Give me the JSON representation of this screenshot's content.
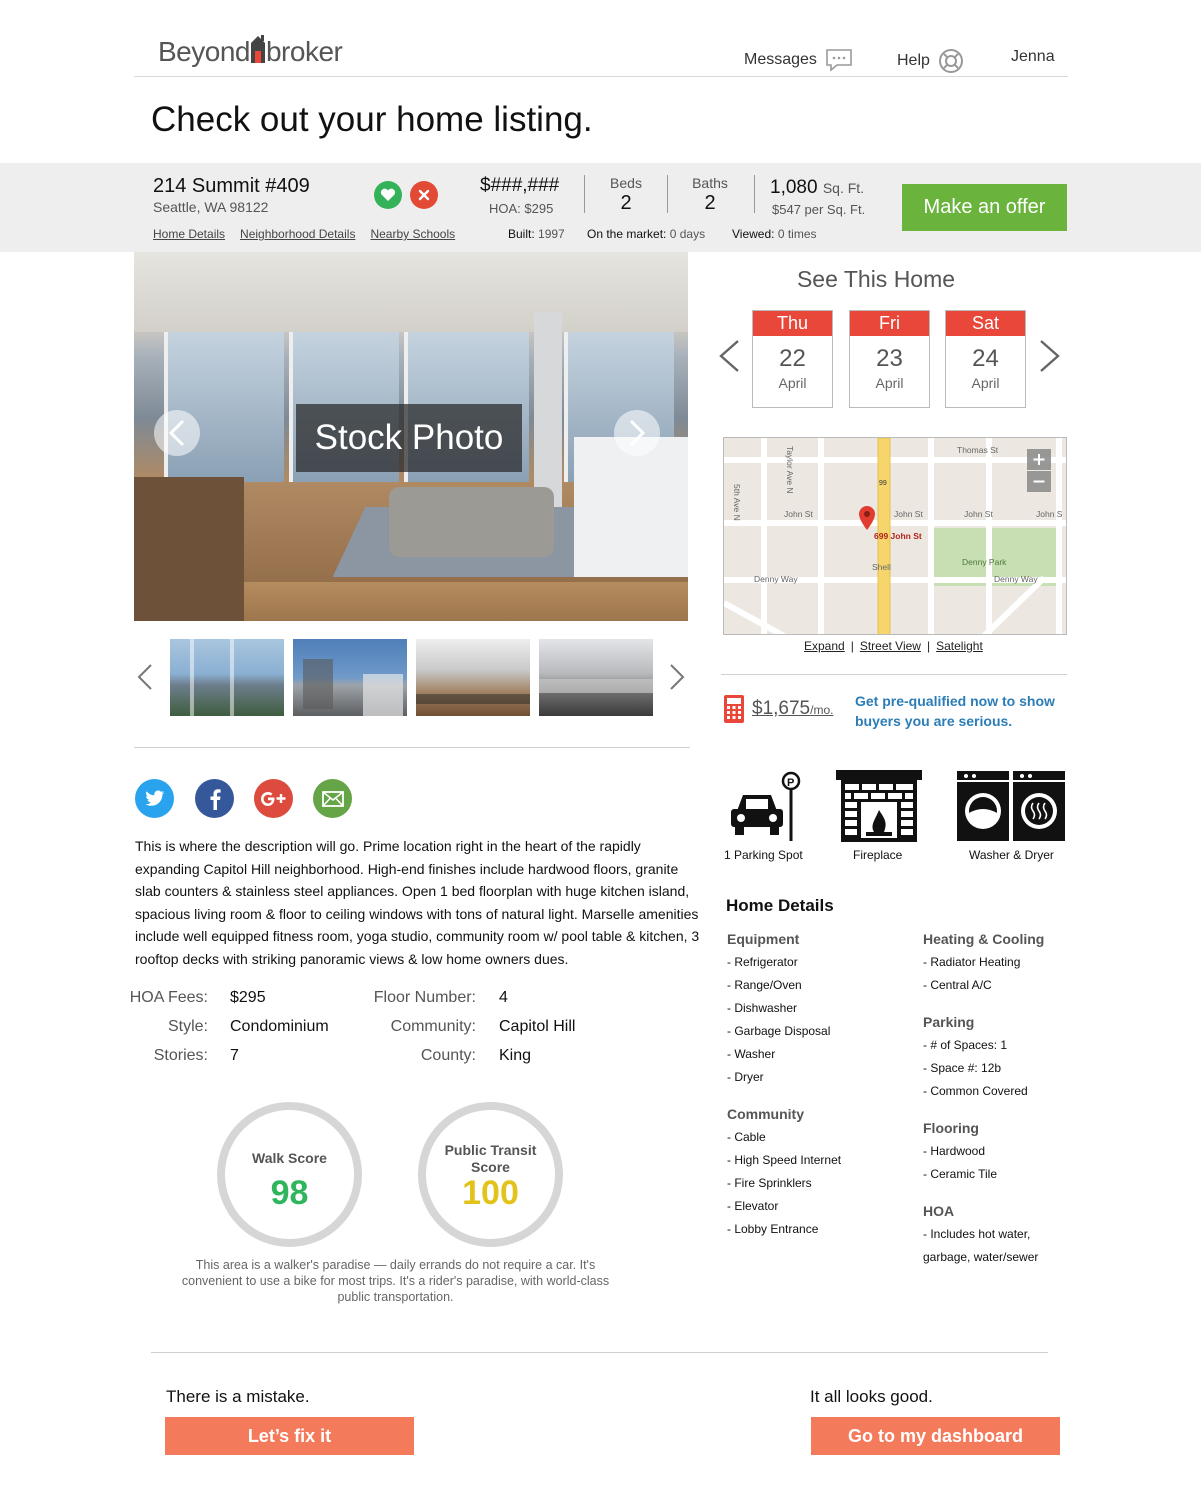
{
  "brand": {
    "name_left": "Beyond",
    "name_right": "broker"
  },
  "nav": {
    "messages": "Messages",
    "help": "Help",
    "user": "Jenna"
  },
  "page_title": "Check out your home listing.",
  "listing": {
    "address_line1": "214 Summit #409",
    "address_line2": "Seattle, WA 98122",
    "price": "$###,###",
    "hoa": "HOA: $295",
    "beds_label": "Beds",
    "beds": "2",
    "baths_label": "Baths",
    "baths": "2",
    "sqft": "1,080",
    "sqft_unit": "Sq. Ft.",
    "price_per_sqft": "$547 per Sq. Ft.",
    "offer_button": "Make an offer",
    "links": [
      "Home Details",
      "Neighborhood Details",
      "Nearby Schools"
    ],
    "built_label": "Built:",
    "built": "1997",
    "market_label": "On the market:",
    "market": "0 days",
    "viewed_label": "Viewed:",
    "viewed": "0 times"
  },
  "gallery": {
    "stock_label": "Stock Photo",
    "thumbnails": 4
  },
  "schedule": {
    "title": "See This Home",
    "days": [
      {
        "dow": "Thu",
        "day": "22",
        "month": "April"
      },
      {
        "dow": "Fri",
        "day": "23",
        "month": "April"
      },
      {
        "dow": "Sat",
        "day": "24",
        "month": "April"
      }
    ]
  },
  "map": {
    "pin_label": "699 John St",
    "streets": [
      "Thomas St",
      "John St",
      "John St",
      "John St",
      "John S",
      "Denny Way",
      "Denny Way",
      "Denny Park",
      "Shell",
      "Taylor Ave N",
      "5th Ave N",
      "99"
    ],
    "links": [
      "Expand",
      "Street View",
      "Satelight"
    ],
    "separator": "|"
  },
  "mortgage": {
    "amount": "$1,675",
    "per": "/mo.",
    "prequal_text": "Get pre-qualified now to show buyers you are serious."
  },
  "amenities": [
    "1 Parking Spot",
    "Fireplace",
    "Washer & Dryer"
  ],
  "description": "This is where the description will go. Prime location right in the heart of the rapidly expanding Capitol Hill neighborhood. High-end finishes include hardwood floors, granite slab counters & stainless steel appliances. Open 1 bed floorplan with huge kitchen island, spacious living room & floor to ceiling windows with tons of natural light. Marselle amenities include well equipped fitness room, yoga studio, community room w/ pool table & kitchen, 3 rooftop decks with striking panoramic views & low home owners dues.",
  "facts": [
    {
      "label": "HOA Fees:",
      "value": "$295"
    },
    {
      "label": "Style:",
      "value": "Condominium"
    },
    {
      "label": "Stories:",
      "value": "7"
    },
    {
      "label": "Floor Number:",
      "value": "4"
    },
    {
      "label": "Community:",
      "value": "Capitol Hill"
    },
    {
      "label": "County:",
      "value": "King"
    }
  ],
  "scores": {
    "walk_title": "Walk Score",
    "walk_value": "98",
    "transit_title_1": "Public Transit",
    "transit_title_2": "Score",
    "transit_value": "100",
    "note": "This area is a walker's paradise — daily errands do not require a car. It's convenient to use a bike for most trips. It's a rider's paradise, with world-class public transportation.",
    "walk_color": "#2fb55c",
    "transit_color": "#e3c21a"
  },
  "home_details": {
    "title": "Home Details",
    "left": [
      {
        "heading": "Equipment",
        "items": [
          "- Refrigerator",
          "- Range/Oven",
          "- Dishwasher",
          "- Garbage Disposal",
          "- Washer",
          "- Dryer"
        ]
      },
      {
        "heading": "Community",
        "items": [
          "- Cable",
          "- High Speed Internet",
          "- Fire Sprinklers",
          "- Elevator",
          "- Lobby Entrance"
        ]
      }
    ],
    "right": [
      {
        "heading": "Heating & Cooling",
        "items": [
          "- Radiator Heating",
          "- Central A/C"
        ]
      },
      {
        "heading": "Parking",
        "items": [
          "- # of Spaces: 1",
          "- Space #: 12b",
          "- Common Covered"
        ]
      },
      {
        "heading": "Flooring",
        "items": [
          "- Hardwood",
          "- Ceramic Tile"
        ]
      },
      {
        "heading": "HOA",
        "items": [
          "- Includes hot water,",
          "garbage, water/sewer"
        ]
      }
    ]
  },
  "footer": {
    "mistake_text": "There is a mistake.",
    "fix_button": "Let’s fix it",
    "good_text": "It all looks good.",
    "dashboard_button": "Go to my dashboard"
  },
  "colors": {
    "accent_green": "#6ab33d",
    "calendar_red": "#e8473a",
    "cta_orange": "#f47a5c",
    "link_blue": "#2b7db7"
  }
}
